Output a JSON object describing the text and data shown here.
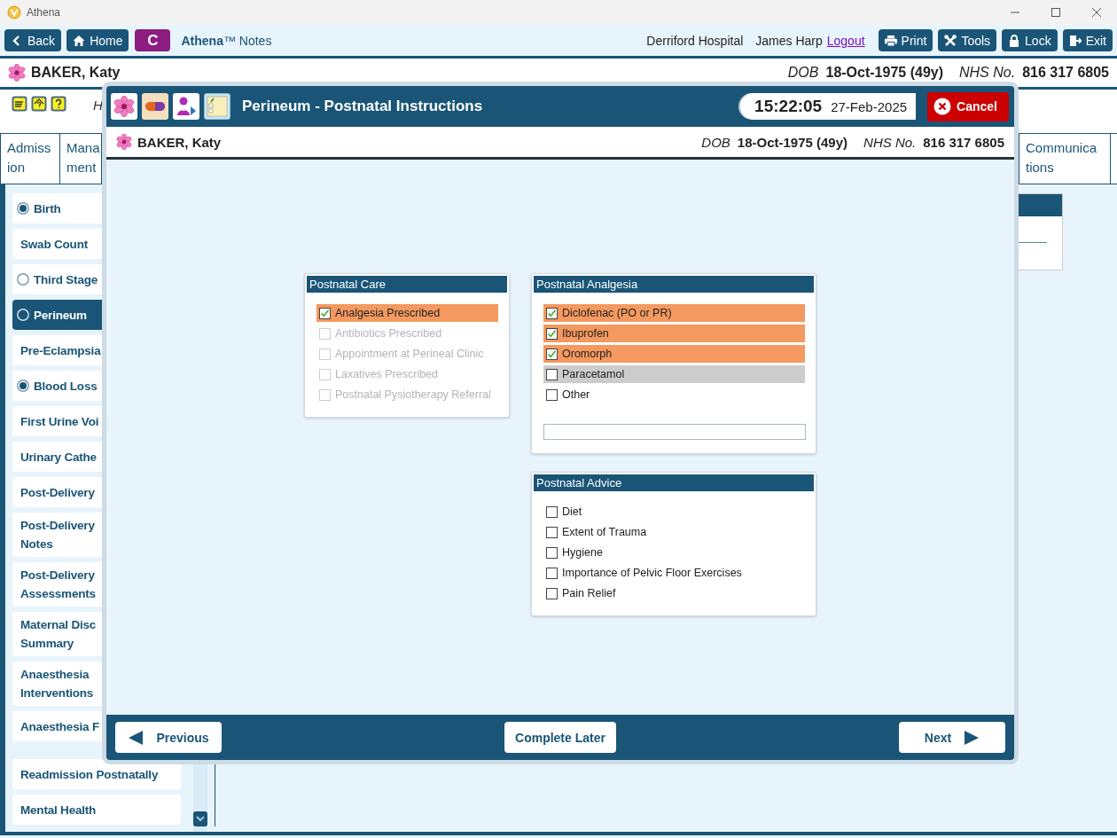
{
  "window": {
    "title": "Athena"
  },
  "toolbar": {
    "buttons": [
      {
        "label": "Back",
        "kind": "back"
      },
      {
        "label": "Home",
        "kind": "home"
      },
      {
        "label": "C",
        "kind": "letter"
      }
    ],
    "app_name": "**Athena**™ Notes",
    "hospital": "Derriford Hospital",
    "user": "James Harp",
    "logout": "Logout",
    "actions": [
      {
        "label": "Print",
        "kind": "print"
      },
      {
        "label": "Tools",
        "kind": "tools"
      },
      {
        "label": "Lock",
        "kind": "lock"
      },
      {
        "label": "Exit",
        "kind": "exit"
      }
    ]
  },
  "patient": {
    "name": "BAKER, Katy",
    "dob_label": "DOB",
    "dob": "18-Oct-1975 (49y)",
    "nhs_label": "NHS No.",
    "nhs": "816 317 6805"
  },
  "alerts": {
    "note": "H"
  },
  "tabs": [
    {
      "lines": [
        "Admiss",
        "ion"
      ],
      "selected": false
    },
    {
      "lines": [
        "Mana",
        "ment"
      ],
      "selected": false
    },
    {
      "lines": [
        "Communica",
        "tions"
      ],
      "selected": false
    }
  ],
  "sidebar": {
    "groups": [
      {
        "items": [
          {
            "lines": [
              "Birth"
            ],
            "kind": "radio",
            "checked": true,
            "selected": false
          },
          {
            "lines": [
              "Swab Count"
            ],
            "kind": "plain",
            "selected": false
          },
          {
            "lines": [
              "Third Stage"
            ],
            "kind": "radio",
            "checked": false,
            "selected": false
          },
          {
            "lines": [
              "Perineum"
            ],
            "kind": "radio",
            "checked": false,
            "selected": true
          },
          {
            "lines": [
              "Pre-Eclampsia"
            ],
            "kind": "plain",
            "selected": false
          },
          {
            "lines": [
              "Blood Loss"
            ],
            "kind": "radio",
            "checked": true,
            "selected": false
          },
          {
            "lines": [
              "First Urine Voi"
            ],
            "kind": "plain",
            "selected": false
          },
          {
            "lines": [
              "Urinary Cathe"
            ],
            "kind": "plain",
            "selected": false
          },
          {
            "lines": [
              "Post-Delivery"
            ],
            "kind": "plain",
            "selected": false
          },
          {
            "lines": [
              "Post-Delivery",
              "Notes"
            ],
            "kind": "plain",
            "selected": false
          },
          {
            "lines": [
              "Post-Delivery",
              "Assessments"
            ],
            "kind": "plain",
            "selected": false
          },
          {
            "lines": [
              "Maternal Disc",
              "Summary"
            ],
            "kind": "plain",
            "selected": false
          },
          {
            "lines": [
              "Anaesthesia",
              "Interventions"
            ],
            "kind": "plain",
            "selected": false
          },
          {
            "lines": [
              "Anaesthesia F"
            ],
            "kind": "plain",
            "selected": false
          }
        ]
      },
      {
        "items": [
          {
            "lines": [
              "Readmission Postnatally"
            ],
            "kind": "plain",
            "selected": false
          },
          {
            "lines": [
              "Mental Health"
            ],
            "kind": "plain",
            "selected": false
          }
        ]
      }
    ]
  },
  "dialog": {
    "title": "Perineum - Postnatal Instructions",
    "time": "15:22:05",
    "date": "27-Feb-2025",
    "cancel": "Cancel",
    "patient": {
      "name": "BAKER, Katy",
      "dob_label": "DOB",
      "dob": "18-Oct-1975 (49y)",
      "nhs_label": "NHS No.",
      "nhs": "816 317 6805"
    },
    "columns": [
      [
        {
          "title": "Postnatal Care",
          "kind": "checklist",
          "items": [
            {
              "label": "Analgesia Prescribed",
              "checked": true,
              "disabled": false
            },
            {
              "label": "Antibiotics Prescribed",
              "checked": false,
              "disabled": true
            },
            {
              "label": "Appointment at Perineal Clinic",
              "checked": false,
              "disabled": true
            },
            {
              "label": "Laxatives Prescribed",
              "checked": false,
              "disabled": true
            },
            {
              "label": "Postnatal Pysiotherapy Referral",
              "checked": false,
              "disabled": true
            }
          ]
        }
      ],
      [
        {
          "title": "Postnatal Analgesia",
          "kind": "checklist_with_field",
          "items": [
            {
              "label": "Diclofenac (PO or PR)",
              "checked": true,
              "focused": false
            },
            {
              "label": "Ibuprofen",
              "checked": true,
              "focused": false
            },
            {
              "label": "Oromorph",
              "checked": true,
              "focused": false
            },
            {
              "label": "Paracetamol",
              "checked": false,
              "focused": true
            },
            {
              "label": "Other",
              "checked": false,
              "focused": false
            }
          ]
        },
        {
          "title": "Postnatal Advice",
          "kind": "checklist",
          "items": [
            {
              "label": "Diet",
              "checked": false
            },
            {
              "label": "Extent of Trauma",
              "checked": false
            },
            {
              "label": "Hygiene",
              "checked": false
            },
            {
              "label": "Importance of Pelvic Floor Exercises",
              "checked": false
            },
            {
              "label": "Pain Relief",
              "checked": false
            }
          ]
        }
      ]
    ],
    "footer": {
      "previous": "Previous",
      "complete_later": "Complete Later",
      "next": "Next"
    }
  }
}
